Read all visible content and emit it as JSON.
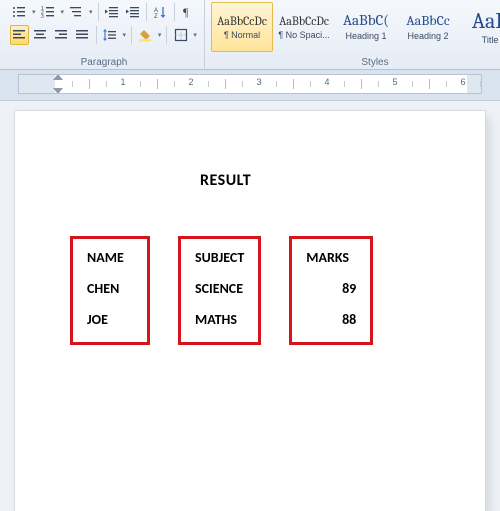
{
  "ribbon": {
    "groups": {
      "paragraph": "Paragraph",
      "styles": "Styles"
    },
    "style_items": [
      {
        "preview": "AaBbCcDc",
        "name": "¶ Normal",
        "class": "body",
        "size": "12px",
        "selected": true
      },
      {
        "preview": "AaBbCcDc",
        "name": "¶ No Spaci...",
        "class": "body",
        "size": "12px",
        "selected": false
      },
      {
        "preview": "AaBbC(",
        "name": "Heading 1",
        "class": "",
        "size": "15px",
        "selected": false
      },
      {
        "preview": "AaBbCc",
        "name": "Heading 2",
        "class": "",
        "size": "14px",
        "selected": false
      },
      {
        "preview": "AaB",
        "name": "Title",
        "class": "",
        "size": "22px",
        "selected": false
      }
    ]
  },
  "ruler_numbers": [
    "1",
    "2",
    "3",
    "4",
    "5",
    "6"
  ],
  "document": {
    "title": "RESULT",
    "columns": [
      {
        "header": "NAME",
        "rows": [
          "CHEN",
          "JOE"
        ],
        "align": "left"
      },
      {
        "header": "SUBJECT",
        "rows": [
          "SCIENCE",
          "MATHS"
        ],
        "align": "left"
      },
      {
        "header": "MARKS",
        "rows": [
          "89",
          "88"
        ],
        "align": "right"
      }
    ]
  }
}
